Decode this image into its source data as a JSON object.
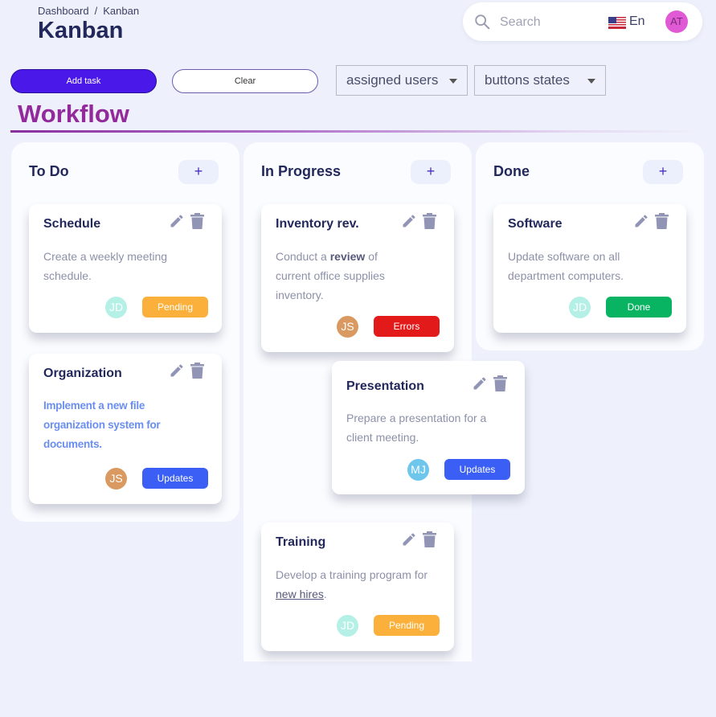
{
  "breadcrumb": {
    "items": [
      "Dashboard",
      "Kanban"
    ],
    "separator": "/"
  },
  "page_title": "Kanban",
  "search": {
    "placeholder": "Search"
  },
  "language": {
    "label": "En",
    "flag": "us-flag-icon"
  },
  "user_avatar": {
    "initials": "AT",
    "color": "#e05ad6"
  },
  "toolbar": {
    "add_task_label": "Add task",
    "clear_label": "Clear",
    "assigned_users_label": "assigned users",
    "buttons_states_label": "buttons states"
  },
  "section_title": "Workflow",
  "colors": {
    "pending": "#fbb03b",
    "errors": "#e21a1a",
    "updates": "#3b5ff5",
    "done": "#08b461",
    "accent": "#932a9b"
  },
  "columns": [
    {
      "title": "To Do",
      "add_label": "+"
    },
    {
      "title": "In Progress",
      "add_label": "+"
    },
    {
      "title": "Done",
      "add_label": "+"
    }
  ],
  "cards": {
    "schedule": {
      "title": "Schedule",
      "description": "Create a weekly meeting schedule.",
      "assignee": "JD",
      "status": "Pending"
    },
    "organization": {
      "title": "Organization",
      "description": "Implement a new file organization system for documents.",
      "assignee": "JS",
      "status": "Updates"
    },
    "inventory": {
      "title": "Inventory rev.",
      "description_prefix": "Conduct a ",
      "description_bold": "review",
      "description_suffix": " of current office supplies inventory.",
      "assignee": "JS",
      "status": "Errors"
    },
    "presentation": {
      "title": "Presentation",
      "description": "Prepare a presentation for a client meeting.",
      "assignee": "MJ",
      "status": "Updates"
    },
    "training": {
      "title": "Training",
      "description_prefix": "Develop a training program for ",
      "description_link": "new hires",
      "description_suffix": ".",
      "assignee": "JD",
      "status": "Pending"
    },
    "software": {
      "title": "Software",
      "description": "Update software on all department computers.",
      "assignee": "JD",
      "status": "Done"
    }
  }
}
